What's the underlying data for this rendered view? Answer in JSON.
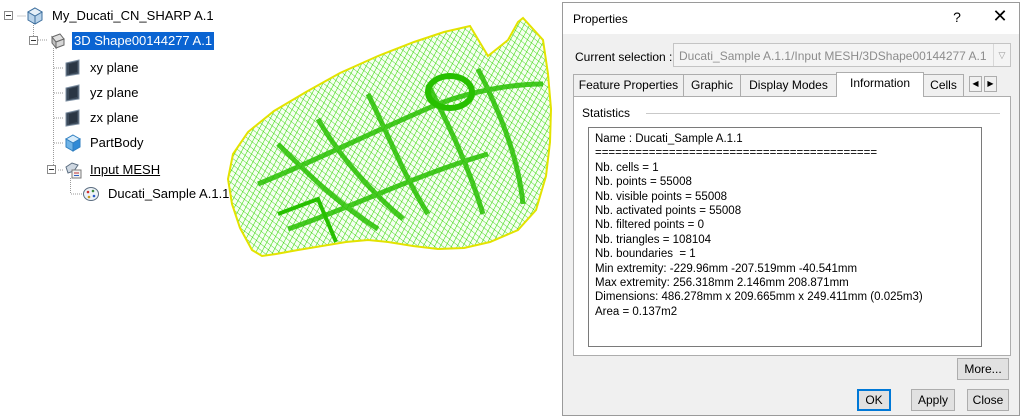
{
  "tree": {
    "root": {
      "label": "My_Ducati_CN_SHARP A.1",
      "icon": "product-icon"
    },
    "shape": {
      "label": "3D Shape00144277 A.1",
      "icon": "part-icon"
    },
    "xy": {
      "label": "xy plane",
      "icon": "plane-icon"
    },
    "yz": {
      "label": "yz plane",
      "icon": "plane-icon"
    },
    "zx": {
      "label": "zx plane",
      "icon": "plane-icon"
    },
    "body": {
      "label": "PartBody",
      "icon": "body-icon"
    },
    "mesh": {
      "label": "Input MESH",
      "icon": "mesh-set-icon"
    },
    "sample": {
      "label": "Ducati_Sample A.1.1",
      "icon": "cloud-icon"
    }
  },
  "mesh_view": {
    "icon": "mesh-surface-icon",
    "wire_color": "#33dd00",
    "border_color": "#e3e300"
  },
  "dialog": {
    "title": "Properties",
    "help": "?",
    "close": "✕",
    "current_selection_label": "Current selection :",
    "current_selection_value": "Ducati_Sample A.1.1/Input MESH/3DShape00144277 A.1",
    "tabs": [
      "Feature Properties",
      "Graphic",
      "Display Modes",
      "Information",
      "Cells"
    ],
    "active_tab": "Information",
    "group_title": "Statistics",
    "statistics": [
      "Name : Ducati_Sample A.1.1",
      "==========================================",
      "Nb. cells = 1",
      "Nb. points = 55008",
      "Nb. visible points = 55008",
      "Nb. activated points = 55008",
      "Nb. filtered points = 0",
      "Nb. triangles = 108104",
      "Nb. boundaries  = 1",
      "Min extremity: -229.96mm -207.519mm -40.541mm",
      "Max extremity: 256.318mm 2.146mm 208.871mm",
      "Dimensions: 486.278mm x 209.665mm x 249.411mm (0.025m3)",
      "Area = 0.137m2"
    ],
    "buttons": {
      "more": "More...",
      "ok": "OK",
      "apply": "Apply",
      "close": "Close"
    }
  }
}
